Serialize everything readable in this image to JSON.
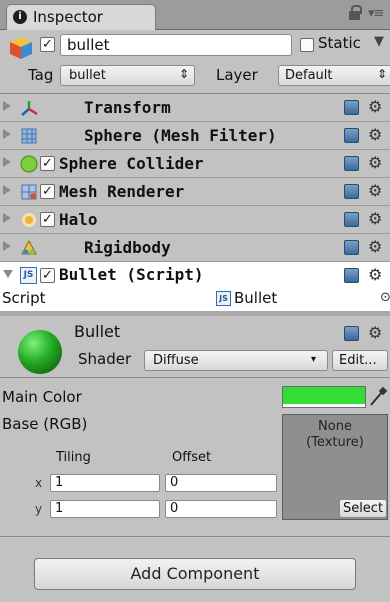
{
  "tab": {
    "title": "Inspector",
    "info_glyph": "i",
    "menu_glyph": "▾≡"
  },
  "header": {
    "object_name": "bullet",
    "static_label": "Static",
    "tag_label": "Tag",
    "tag_value": "bullet",
    "layer_label": "Layer",
    "layer_value": "Default"
  },
  "components": [
    {
      "label": "Transform",
      "icon": "transform-icon",
      "has_checkbox": false
    },
    {
      "label": "Sphere (Mesh Filter)",
      "icon": "mesh-filter-icon",
      "has_checkbox": false
    },
    {
      "label": "Sphere Collider",
      "icon": "sphere-collider-icon",
      "has_checkbox": true
    },
    {
      "label": "Mesh Renderer",
      "icon": "mesh-renderer-icon",
      "has_checkbox": true
    },
    {
      "label": "Halo",
      "icon": "halo-icon",
      "has_checkbox": true
    },
    {
      "label": "Rigidbody",
      "icon": "rigidbody-icon",
      "has_checkbox": false
    },
    {
      "label": "Bullet (Script)",
      "icon": "script-icon",
      "has_checkbox": true
    }
  ],
  "script": {
    "label": "Script",
    "value": "Bullet",
    "js_badge": "JS",
    "trailing": "⊙"
  },
  "material": {
    "name": "Bullet",
    "shader_label": "Shader",
    "shader_value": "Diffuse",
    "edit_label": "Edit...",
    "main_color_label": "Main Color",
    "main_color": "#33dd33",
    "base_label": "Base (RGB)",
    "texture_none": "None",
    "texture_type": "(Texture)",
    "select_label": "Select",
    "tiling_label": "Tiling",
    "offset_label": "Offset",
    "x_label": "x",
    "y_label": "y",
    "tiling_x": "1",
    "tiling_y": "1",
    "offset_x": "0",
    "offset_y": "0"
  },
  "footer": {
    "add_component": "Add Component"
  },
  "colors": {
    "selected_row_bg": "#ffffff",
    "panel_bg": "#c2c2c2",
    "sphere_green": "#22aa22"
  }
}
